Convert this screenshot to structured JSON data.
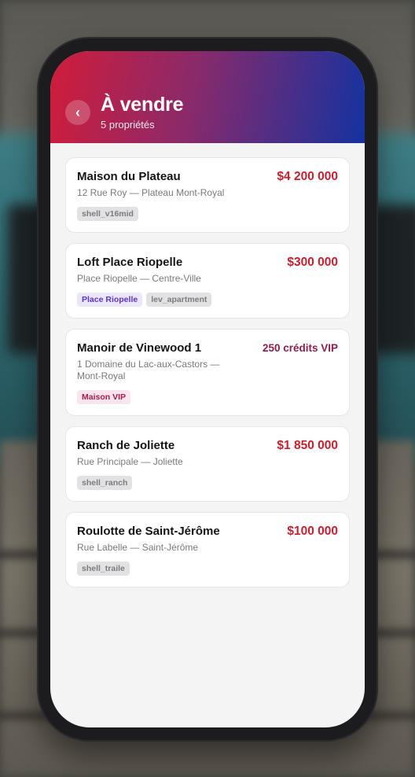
{
  "header": {
    "title": "À vendre",
    "subtitle": "5 propriétés",
    "back_icon": "‹"
  },
  "colors": {
    "header_gradient": [
      "#d11c3a",
      "#8a2a6a",
      "#1432a0"
    ],
    "price": "#c8202f",
    "vip_price": "#8c1d4f"
  },
  "properties": [
    {
      "name": "Maison du Plateau",
      "price": "$4 200 000",
      "address": "12 Rue Roy — Plateau Mont-Royal",
      "tags": [
        {
          "label": "shell_v16mid",
          "style": "gray"
        }
      ]
    },
    {
      "name": "Loft Place Riopelle",
      "price": "$300 000",
      "address": "Place Riopelle — Centre-Ville",
      "tags": [
        {
          "label": "Place Riopelle",
          "style": "purple"
        },
        {
          "label": "lev_apartment",
          "style": "gray"
        }
      ]
    },
    {
      "name": "Manoir de Vinewood 1",
      "price": "250 crédits VIP",
      "address": "1 Domaine du Lac-aux-Castors — Mont-Royal",
      "tags": [
        {
          "label": "Maison VIP",
          "style": "pink"
        }
      ]
    },
    {
      "name": "Ranch de Joliette",
      "price": "$1 850 000",
      "address": "Rue Principale — Joliette",
      "tags": [
        {
          "label": "shell_ranch",
          "style": "gray"
        }
      ]
    },
    {
      "name": "Roulotte de Saint-Jérôme",
      "price": "$100 000",
      "address": "Rue Labelle — Saint-Jérôme",
      "tags": [
        {
          "label": "shell_traile",
          "style": "gray"
        }
      ]
    }
  ]
}
